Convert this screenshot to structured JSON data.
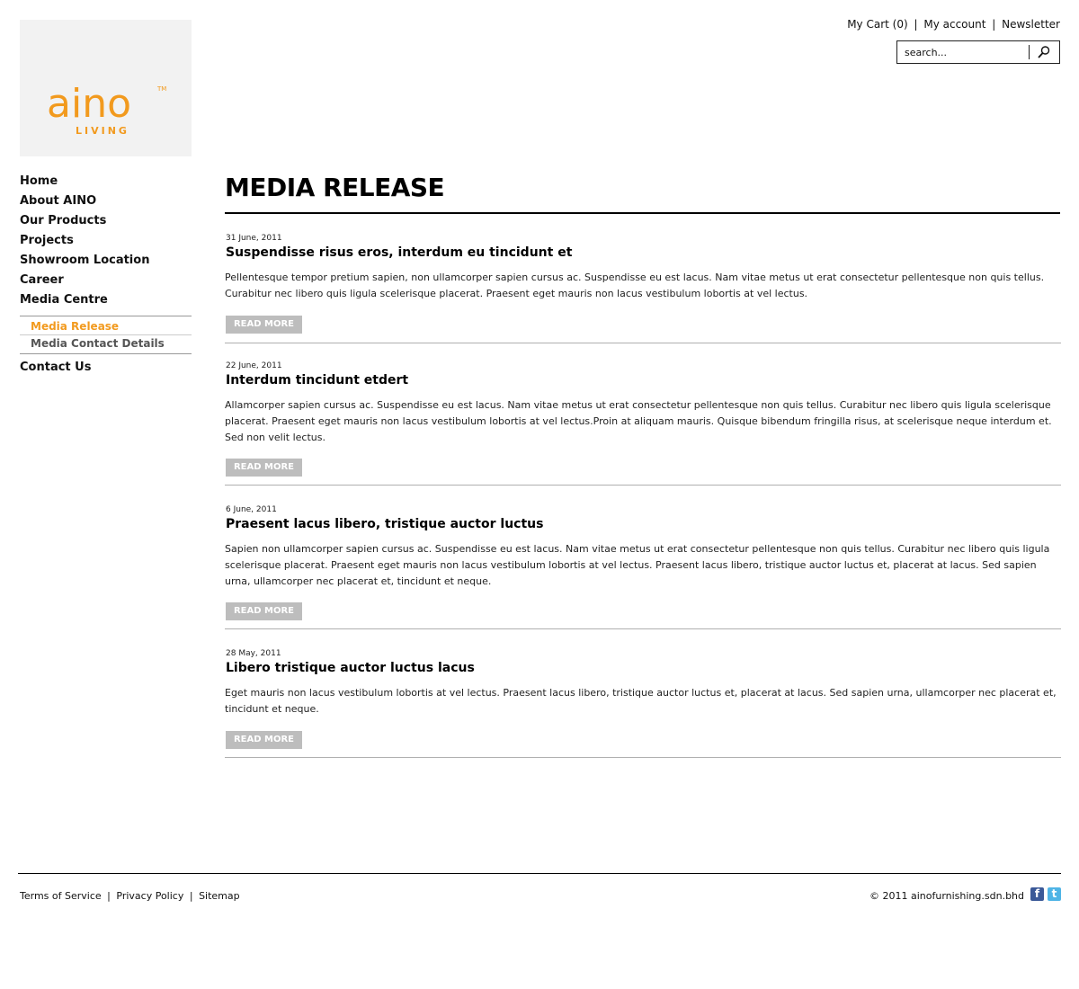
{
  "logo": {
    "word": "aino",
    "tm": "TM",
    "sub": "LIVING",
    "color": "#f29a1e"
  },
  "header": {
    "cart": "My Cart (0)",
    "account": "My account",
    "newsletter": "Newsletter",
    "separator": "|",
    "search_placeholder": "search..."
  },
  "sidebar": {
    "items": [
      "Home",
      "About AINO",
      "Our Products",
      "Projects",
      "Showroom Location",
      "Career",
      "Media Centre"
    ],
    "subitems": [
      "Media Release",
      "Media Contact Details"
    ],
    "contact": "Contact Us",
    "active_color": "#f29a1e"
  },
  "main": {
    "title": "MEDIA RELEASE",
    "read_more": "READ MORE",
    "articles": [
      {
        "date": "31 June, 2011",
        "headline": "Suspendisse risus eros, interdum eu tincidunt et",
        "body": "Pellentesque tempor pretium sapien, non ullamcorper sapien cursus ac. Suspendisse eu est lacus. Nam vitae metus ut erat consectetur pellentesque non quis tellus. Curabitur nec libero quis ligula scelerisque placerat. Praesent eget mauris non lacus vestibulum lobortis at vel lectus."
      },
      {
        "date": "22 June, 2011",
        "headline": "Interdum tincidunt etdert",
        "body": "Allamcorper sapien cursus ac. Suspendisse eu est lacus. Nam vitae metus ut erat consectetur pellentesque non quis tellus. Curabitur nec libero quis ligula scelerisque placerat. Praesent eget mauris non lacus vestibulum lobortis at vel lectus.Proin at aliquam mauris. Quisque bibendum fringilla risus, at scelerisque neque interdum et. Sed non velit lectus."
      },
      {
        "date": "6 June, 2011",
        "headline": "Praesent lacus libero, tristique auctor luctus",
        "body": "Sapien non ullamcorper sapien cursus ac. Suspendisse eu est lacus. Nam vitae metus ut erat consectetur pellentesque non quis tellus. Curabitur nec libero quis ligula scelerisque placerat. Praesent eget mauris non lacus vestibulum lobortis at vel lectus. Praesent lacus libero, tristique auctor luctus et, placerat at lacus. Sed sapien urna, ullamcorper nec placerat et, tincidunt et neque."
      },
      {
        "date": "28 May, 2011",
        "headline": "Libero tristique auctor luctus lacus",
        "body": "Eget mauris non lacus vestibulum lobortis at vel lectus. Praesent lacus libero, tristique auctor luctus et, placerat at lacus. Sed sapien urna, ullamcorper nec placerat et, tincidunt et neque."
      }
    ]
  },
  "footer": {
    "links": [
      "Terms of Service",
      "Privacy Policy",
      "Sitemap"
    ],
    "separator": "|",
    "copyright": "© 2011 ainofurnishing.sdn.bhd",
    "social": [
      {
        "name": "facebook-icon",
        "glyph": "f",
        "color": "#3b5998"
      },
      {
        "name": "twitter-icon",
        "glyph": "t",
        "color": "#4fb4e6"
      }
    ]
  }
}
